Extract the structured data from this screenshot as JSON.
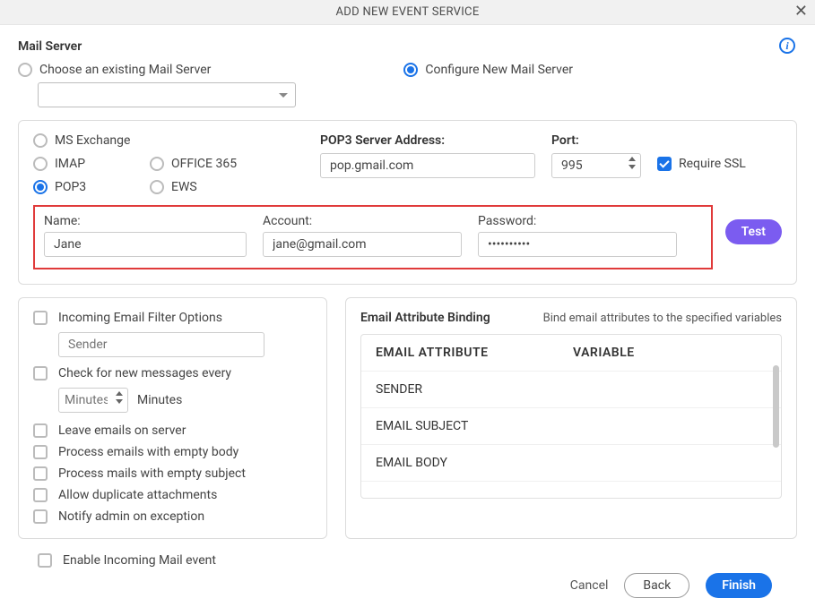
{
  "titlebar": {
    "title": "ADD NEW EVENT SERVICE"
  },
  "section": {
    "title": "Mail Server",
    "choose_existing": "Choose an existing Mail Server",
    "configure_new": "Configure New Mail Server"
  },
  "protocols": {
    "ms_exchange": "MS Exchange",
    "imap": "IMAP",
    "pop3": "POP3",
    "office365": "OFFICE 365",
    "ews": "EWS"
  },
  "server": {
    "pop3_label": "POP3 Server Address:",
    "pop3_value": "pop.gmail.com",
    "port_label": "Port:",
    "port_value": "995",
    "require_ssl": "Require SSL"
  },
  "creds": {
    "name_label": "Name:",
    "name_value": "Jane",
    "account_label": "Account:",
    "account_value": "jane@gmail.com",
    "password_label": "Password:",
    "password_value": "••••••••••",
    "test": "Test"
  },
  "filter": {
    "incoming_filter": "Incoming Email Filter Options",
    "sender_placeholder": "Sender",
    "check_every": "Check for new messages every",
    "minutes_placeholder": "Minutes",
    "minutes_label": "Minutes",
    "leave_on_server": "Leave emails on server",
    "empty_body": "Process emails with empty body",
    "empty_subject": "Process mails with empty subject",
    "allow_dup_attach": "Allow duplicate attachments",
    "notify_admin": "Notify admin on exception"
  },
  "binding": {
    "title": "Email Attribute Binding",
    "subtitle": "Bind email attributes to the specified variables",
    "header_attr": "EMAIL ATTRIBUTE",
    "header_var": "VARIABLE",
    "rows": [
      "SENDER",
      "EMAIL SUBJECT",
      "EMAIL BODY"
    ]
  },
  "enable_incoming": "Enable Incoming Mail event",
  "footer": {
    "cancel": "Cancel",
    "back": "Back",
    "finish": "Finish"
  }
}
